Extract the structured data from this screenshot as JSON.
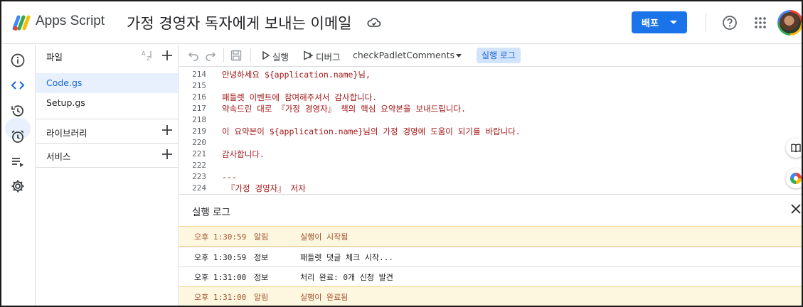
{
  "header": {
    "app_name": "Apps Script",
    "project_title": "가정 경영자 독자에게 보내는 이메일",
    "deploy_label": "배포"
  },
  "sidebar": {
    "files_title": "파일",
    "files": [
      {
        "name": "Code.gs",
        "active": true
      },
      {
        "name": "Setup.gs",
        "active": false
      }
    ],
    "libraries_label": "라이브러리",
    "services_label": "서비스"
  },
  "toolbar": {
    "run_label": "실행",
    "debug_label": "디버그",
    "function_name": "checkPadletComments",
    "log_label": "실행 로그"
  },
  "editor": {
    "lines": [
      {
        "num": "214",
        "code": "안녕하세요 ${application.name}님,"
      },
      {
        "num": "215",
        "code": ""
      },
      {
        "num": "216",
        "code": "패들렛 이벤트에 참여해주셔서 감사합니다."
      },
      {
        "num": "217",
        "code": "약속드린 대로 『가정 경영자』 책의 핵심 요약본을 보내드립니다."
      },
      {
        "num": "218",
        "code": ""
      },
      {
        "num": "219",
        "code": "이 요약본이 ${application.name}님의 가정 경영에 도움이 되기를 바랍니다."
      },
      {
        "num": "220",
        "code": ""
      },
      {
        "num": "221",
        "code": "감사합니다."
      },
      {
        "num": "222",
        "code": ""
      },
      {
        "num": "223",
        "code": "---"
      },
      {
        "num": "224",
        "code": " 『가정 경영자』 저자"
      }
    ]
  },
  "log": {
    "title": "실행 로그",
    "rows": [
      {
        "time": "오후 1:30:59",
        "level": "알림",
        "message": "실행이 시작됨",
        "warn": true
      },
      {
        "time": "오후 1:30:59",
        "level": "정보",
        "message": "패들렛 댓글 체크 시작...",
        "warn": false
      },
      {
        "time": "오후 1:31:00",
        "level": "정보",
        "message": "처리 완료: 0개 신청 발견",
        "warn": false
      },
      {
        "time": "오후 1:31:00",
        "level": "알림",
        "message": "실행이 완료됨",
        "warn": true
      }
    ]
  },
  "colors": {
    "accent": "#1a73e8",
    "active_bg": "#e8f0fe",
    "warn_bg": "#fef7e0",
    "code_string": "#a31515"
  }
}
